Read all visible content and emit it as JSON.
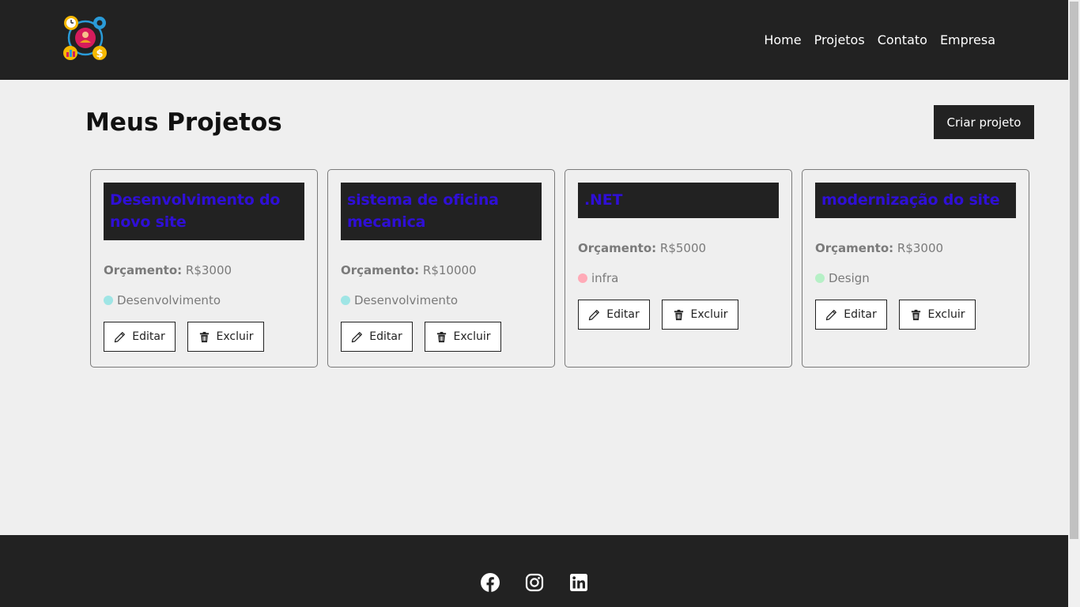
{
  "nav": {
    "logo_icon": "team-finance-logo-icon",
    "links": [
      "Home",
      "Projetos",
      "Contato",
      "Empresa"
    ]
  },
  "page": {
    "title": "Meus Projetos",
    "create_button": "Criar projeto"
  },
  "projects": [
    {
      "title": "Desenvolvimento do novo site",
      "budget_label": "Orçamento:",
      "budget": "R$3000",
      "category": "Desenvolvimento",
      "category_color": "#9fe5e5",
      "edit_label": "Editar",
      "delete_label": "Excluir"
    },
    {
      "title": "sistema de oficina mecanica",
      "budget_label": "Orçamento:",
      "budget": "R$10000",
      "category": "Desenvolvimento",
      "category_color": "#9fe5e5",
      "edit_label": "Editar",
      "delete_label": "Excluir"
    },
    {
      "title": ".NET",
      "budget_label": "Orçamento:",
      "budget": "R$5000",
      "category": "infra",
      "category_color": "#ffaab7",
      "edit_label": "Editar",
      "delete_label": "Excluir"
    },
    {
      "title": "modernização do site",
      "budget_label": "Orçamento:",
      "budget": "R$3000",
      "category": "Design",
      "category_color": "#b6f0c6",
      "edit_label": "Editar",
      "delete_label": "Excluir"
    }
  ],
  "colors": {
    "nav_bg": "#222222",
    "page_bg": "#efefef",
    "title_blue": "#2f0fd6"
  },
  "footer": {
    "icons": [
      "facebook-icon",
      "instagram-icon",
      "linkedin-icon"
    ]
  }
}
